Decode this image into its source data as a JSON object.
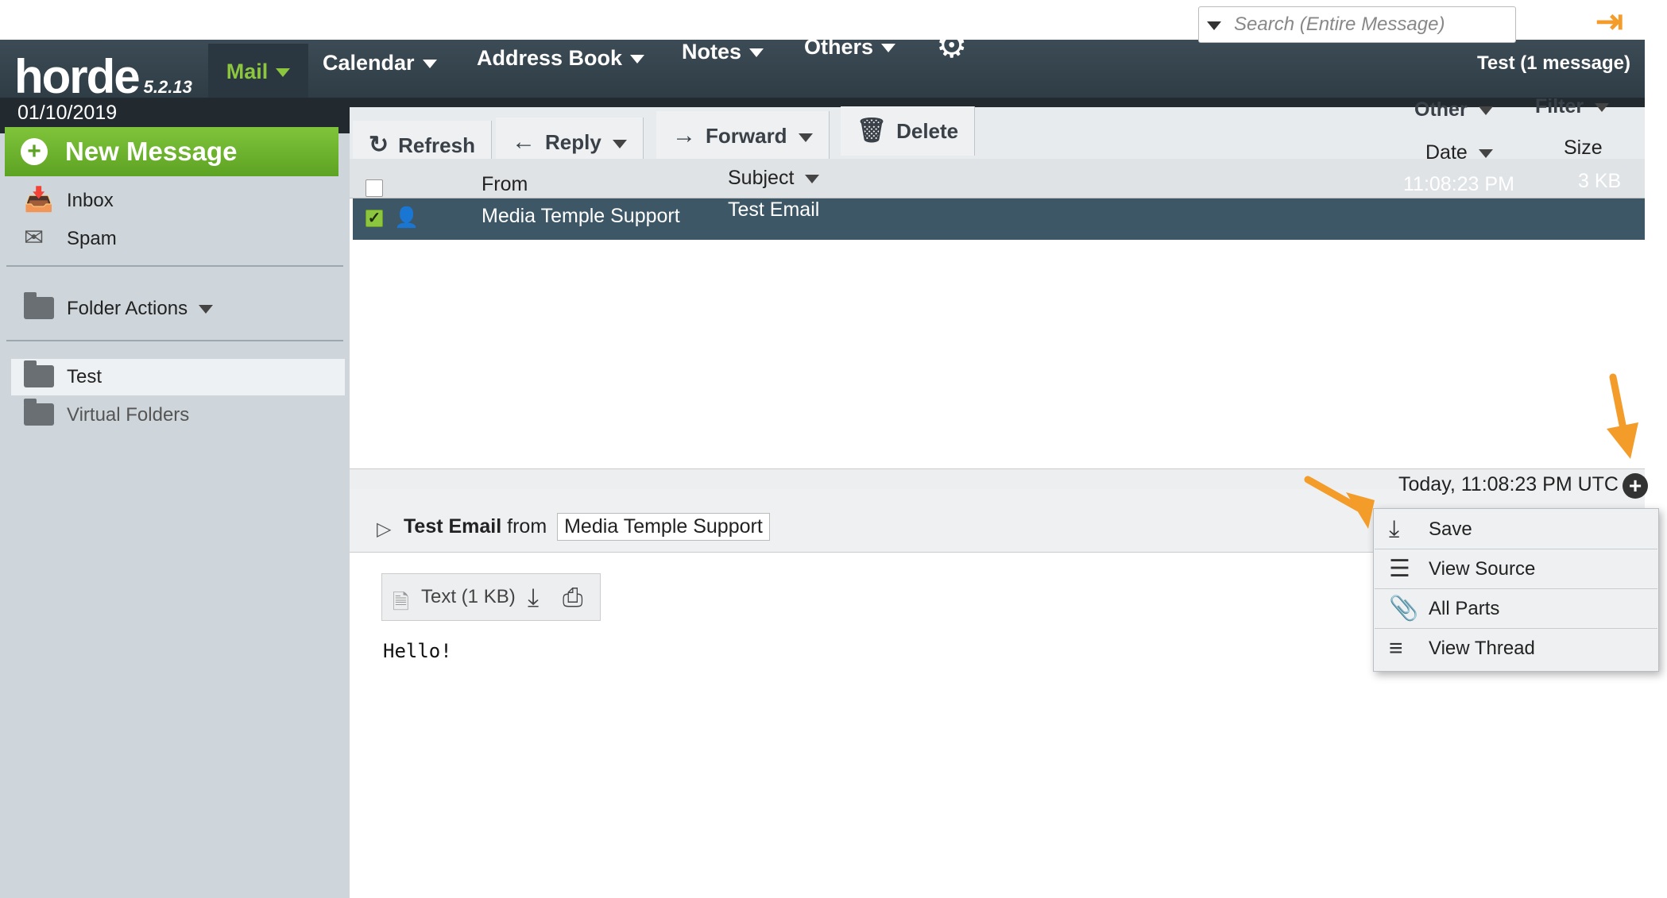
{
  "app": {
    "logo": "horde",
    "version": "5.2.13",
    "date": "01/10/2019",
    "folder_status": "Test (1 message)"
  },
  "nav": {
    "mail": "Mail",
    "calendar": "Calendar",
    "address_book": "Address Book",
    "notes": "Notes",
    "others": "Others"
  },
  "search": {
    "placeholder": "Search (Entire Message)"
  },
  "sidebar": {
    "new_message": "New Message",
    "inbox": "Inbox",
    "spam": "Spam",
    "folder_actions": "Folder Actions",
    "test": "Test",
    "virtual_folders": "Virtual Folders"
  },
  "toolbar": {
    "refresh": "Refresh",
    "reply": "Reply",
    "forward": "Forward",
    "delete": "Delete",
    "other": "Other",
    "filter": "Filter"
  },
  "list": {
    "headers": {
      "from": "From",
      "subject": "Subject",
      "date": "Date",
      "size": "Size"
    },
    "rows": [
      {
        "from": "Media Temple Support",
        "subject": "Test Email",
        "date": "11:08:23 PM",
        "size": "3 KB"
      }
    ]
  },
  "preview": {
    "subject": "Test Email",
    "from_label": "from",
    "from": "Media Temple Support",
    "time": "Today, 11:08:23 PM UTC",
    "attachment": "Text (1 KB)",
    "body": "Hello!"
  },
  "menu": {
    "save": "Save",
    "view_source": "View Source",
    "all_parts": "All Parts",
    "view_thread": "View Thread"
  },
  "colors": {
    "accent_green": "#8cc63e",
    "nav_dark": "#2c3a43",
    "selected_row": "#3d5766",
    "annotation_orange": "#f39c2a"
  }
}
